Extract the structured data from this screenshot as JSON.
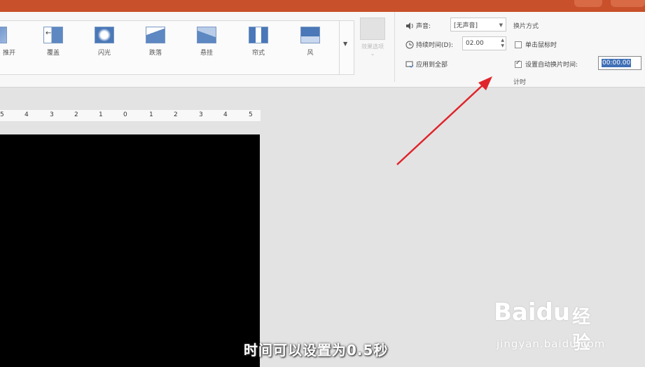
{
  "transitions": [
    {
      "label": "推开",
      "icon": "push-icon"
    },
    {
      "label": "覆盖",
      "icon": "cover-icon"
    },
    {
      "label": "闪光",
      "icon": "flash-icon"
    },
    {
      "label": "跌落",
      "icon": "fall-over-icon"
    },
    {
      "label": "悬挂",
      "icon": "drape-icon"
    },
    {
      "label": "帘式",
      "icon": "curtains-icon"
    },
    {
      "label": "风",
      "icon": "wind-icon"
    }
  ],
  "effect_options": "效果选项",
  "timing": {
    "sound_label": "声音:",
    "sound_value": "[无声音]",
    "duration_label": "持续时间(D):",
    "duration_value": "02.00",
    "apply_all": "应用到全部",
    "advance_heading": "换片方式",
    "on_click": "单击鼠标时",
    "after_label": "设置自动换片时间:",
    "after_value": "00:00.00",
    "group_label": "计时"
  },
  "ruler_ticks": [
    "5",
    "4",
    "3",
    "2",
    "1",
    "0",
    "1",
    "2",
    "3",
    "4",
    "5"
  ],
  "subtitle": "时间可以设置为0.5秒",
  "watermark": {
    "brand": "Baidu",
    "jingyan": "经验",
    "url": "jingyan.baidu.com"
  },
  "colors": {
    "titlebar": "#c8502a",
    "arrow": "#e0242b"
  }
}
